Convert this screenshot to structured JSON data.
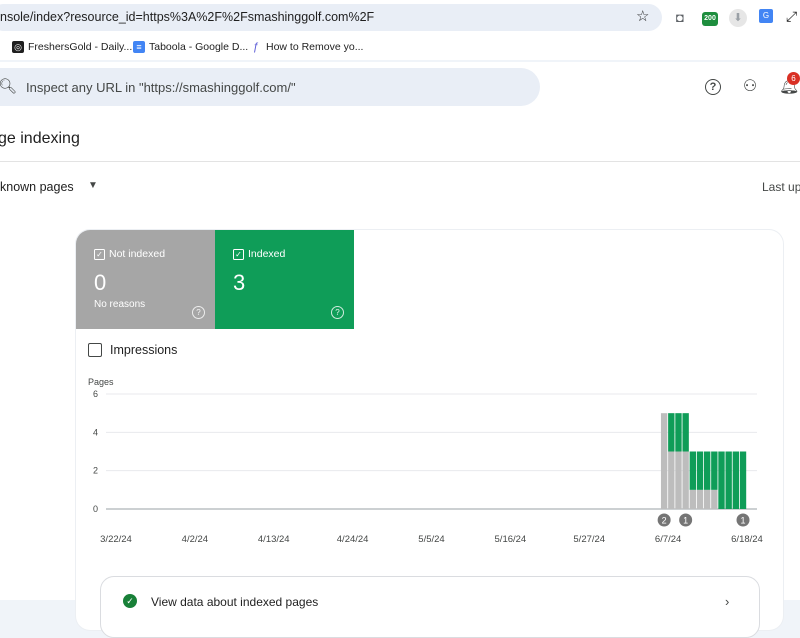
{
  "browser": {
    "url": "nsole/index?resource_id=https%3A%2F%2Fsmashinggolf.com%2F",
    "badge": "200",
    "bookmarks": [
      {
        "label": "FreshersGold - Daily...",
        "icon": "freshersgold-icon",
        "color": "#1f1f1f",
        "glyph": "◎"
      },
      {
        "label": "Taboola - Google D...",
        "icon": "google-docs-icon",
        "color": "#4285f4",
        "glyph": "≡"
      },
      {
        "label": "How to Remove yo...",
        "icon": "feather-icon",
        "color": "#5b5bd6",
        "glyph": "ƒ"
      }
    ]
  },
  "header": {
    "search_placeholder": "Inspect any URL in \"https://smashinggolf.com/\"",
    "notification_count": "6"
  },
  "main": {
    "title": "ge indexing",
    "filter_label": "known pages",
    "last_updated": "Last up"
  },
  "stats": {
    "not_indexed": {
      "label": "Not indexed",
      "value": "0",
      "sub": "No reasons"
    },
    "indexed": {
      "label": "Indexed",
      "value": "3"
    }
  },
  "impressions_label": "Impressions",
  "view_data_label": "View data about indexed pages",
  "colors": {
    "indexed": "#0f9d58",
    "not_indexed": "#bdbdbd",
    "badge": "#d93025"
  },
  "chart_data": {
    "type": "bar",
    "stacked": true,
    "ylabel": "Pages",
    "ylim": [
      0,
      6
    ],
    "yticks": [
      0,
      2,
      4,
      6
    ],
    "date_range": [
      "2024-03-22",
      "2024-06-20"
    ],
    "xticks": [
      {
        "label": "3/22/24",
        "date": "2024-03-22"
      },
      {
        "label": "4/2/24",
        "date": "2024-04-02"
      },
      {
        "label": "4/13/24",
        "date": "2024-04-13"
      },
      {
        "label": "4/24/24",
        "date": "2024-04-24"
      },
      {
        "label": "5/5/24",
        "date": "2024-05-05"
      },
      {
        "label": "5/16/24",
        "date": "2024-05-16"
      },
      {
        "label": "5/27/24",
        "date": "2024-05-27"
      },
      {
        "label": "6/7/24",
        "date": "2024-06-07"
      },
      {
        "label": "6/18/24",
        "date": "2024-06-18"
      }
    ],
    "bars": [
      {
        "date": "2024-06-06",
        "not_indexed": 5,
        "indexed": 0
      },
      {
        "date": "2024-06-07",
        "not_indexed": 3,
        "indexed": 2
      },
      {
        "date": "2024-06-08",
        "not_indexed": 3,
        "indexed": 2
      },
      {
        "date": "2024-06-09",
        "not_indexed": 3,
        "indexed": 2
      },
      {
        "date": "2024-06-10",
        "not_indexed": 1,
        "indexed": 2
      },
      {
        "date": "2024-06-11",
        "not_indexed": 1,
        "indexed": 2
      },
      {
        "date": "2024-06-12",
        "not_indexed": 1,
        "indexed": 2
      },
      {
        "date": "2024-06-13",
        "not_indexed": 1,
        "indexed": 2
      },
      {
        "date": "2024-06-14",
        "not_indexed": 0,
        "indexed": 3
      },
      {
        "date": "2024-06-15",
        "not_indexed": 0,
        "indexed": 3
      },
      {
        "date": "2024-06-16",
        "not_indexed": 0,
        "indexed": 3
      },
      {
        "date": "2024-06-17",
        "not_indexed": 0,
        "indexed": 3
      }
    ],
    "annotations": [
      {
        "date": "2024-06-06",
        "label": "2"
      },
      {
        "date": "2024-06-09",
        "label": "1"
      },
      {
        "date": "2024-06-17",
        "label": "1"
      }
    ]
  }
}
